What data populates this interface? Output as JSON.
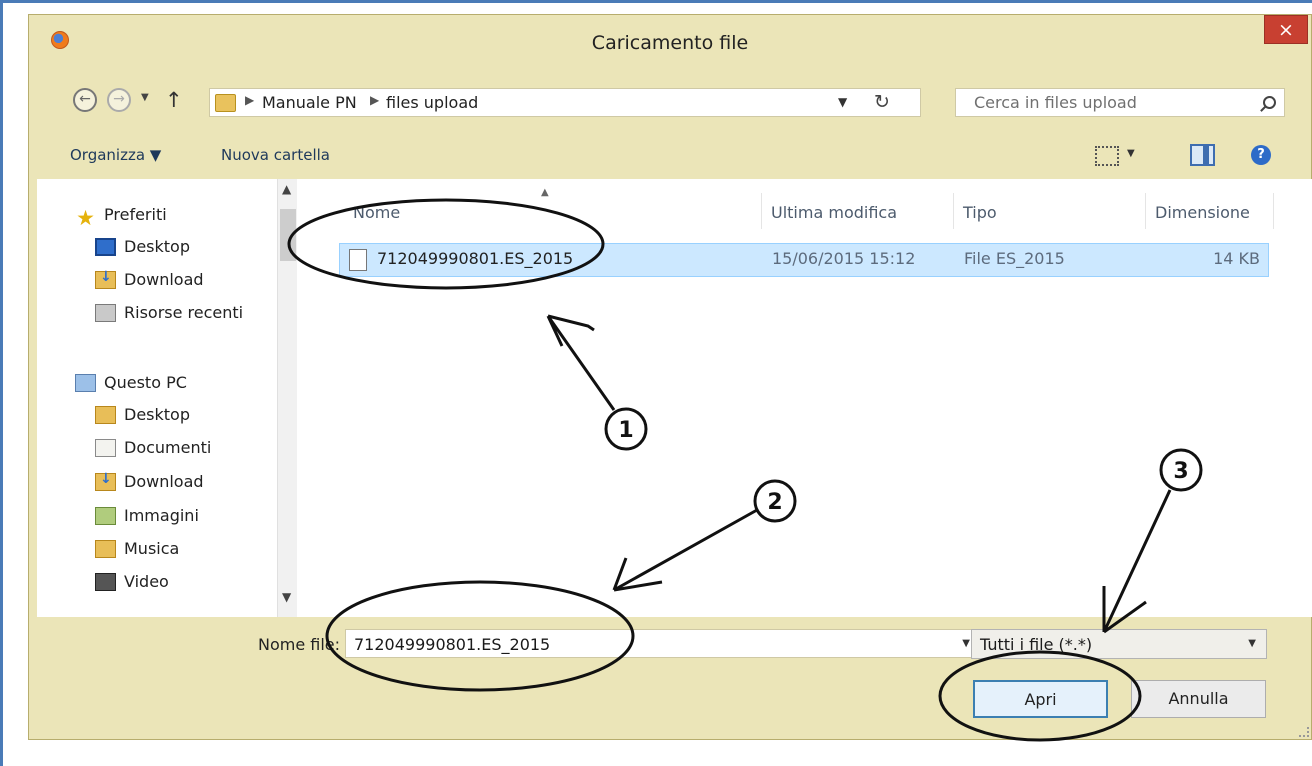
{
  "window": {
    "title": "Caricamento file",
    "close_symbol": "×"
  },
  "nav": {
    "breadcrumb": [
      "Manuale PN",
      "files upload"
    ],
    "search_placeholder": "Cerca in files upload"
  },
  "toolbar": {
    "organize_label": "Organizza ▼",
    "new_folder_label": "Nuova cartella",
    "help_symbol": "?"
  },
  "sidebar": {
    "favorites_label": "Preferiti",
    "favorites": [
      "Desktop",
      "Download",
      "Risorse recenti"
    ],
    "pc_label": "Questo PC",
    "pc_items": [
      "Desktop",
      "Documenti",
      "Download",
      "Immagini",
      "Musica",
      "Video"
    ]
  },
  "columns": [
    "Nome",
    "Ultima modifica",
    "Tipo",
    "Dimensione"
  ],
  "files": [
    {
      "name": "712049990801.ES_2015",
      "modified": "15/06/2015 15:12",
      "type": "File ES_2015",
      "size": "14 KB"
    }
  ],
  "bottom": {
    "filename_label": "Nome file:",
    "filename_value": "712049990801.ES_2015",
    "filter_value": "Tutti i file (*.*)",
    "open_label": "Apri",
    "cancel_label": "Annulla"
  },
  "annotations": [
    "1",
    "2",
    "3"
  ],
  "colors": {
    "accent": "#3c7fb1",
    "selection": "#cce8ff",
    "window_bg": "#ebe5b8",
    "close": "#c84031"
  },
  "icons": [
    "firefox-icon",
    "back-icon",
    "forward-icon",
    "up-arrow-icon",
    "folder-icon",
    "refresh-icon",
    "search-icon",
    "view-icon",
    "preview-pane-icon",
    "help-icon",
    "star-icon",
    "desktop-icon",
    "download-icon",
    "recent-icon",
    "computer-icon",
    "documents-icon",
    "images-icon",
    "music-icon",
    "video-icon",
    "file-icon"
  ]
}
